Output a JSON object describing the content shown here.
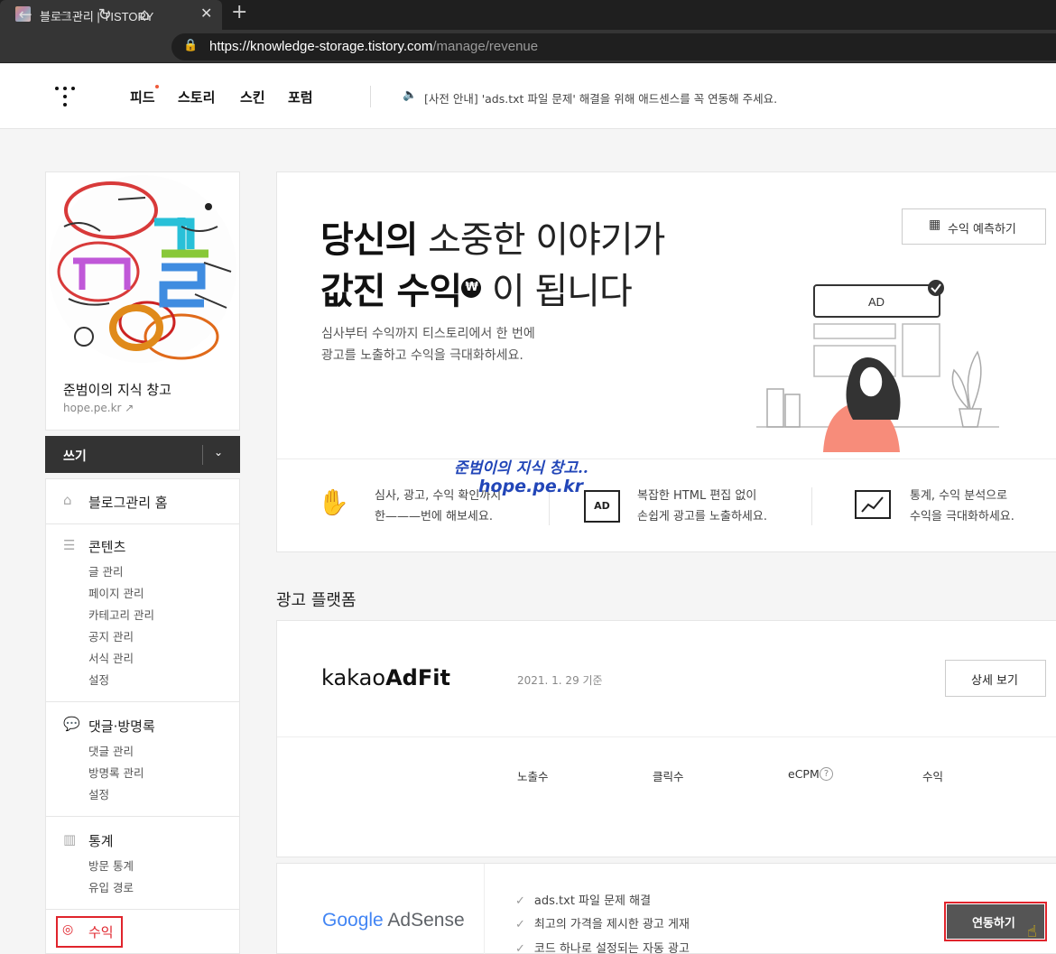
{
  "browser": {
    "tab_title": "블로그관리 | TISTORY",
    "close_glyph": "✕",
    "newtab_glyph": "+",
    "url_host": "https://knowledge-storage.tistory.com",
    "url_path": "/manage/revenue",
    "back": "←",
    "forward": "→",
    "reload": "↻",
    "home": "⌂",
    "lock": "🔒"
  },
  "topnav": {
    "items": [
      "피드",
      "스토리",
      "스킨",
      "포럼"
    ],
    "notice": "[사전 안내] 'ads.txt 파일 문제' 해결을 위해 애드센스를 꼭 연동해 주세요.",
    "speaker": "🔈"
  },
  "sidebar": {
    "blog_name": "준범이의 지식 창고",
    "blog_url": "hope.pe.kr ↗",
    "write_label": "쓰기",
    "write_dropdown": "⌄",
    "home_label": "블로그관리 홈",
    "sections": [
      {
        "title": "콘텐츠",
        "items": [
          "글 관리",
          "페이지 관리",
          "카테고리 관리",
          "공지 관리",
          "서식 관리",
          "설정"
        ]
      },
      {
        "title": "댓글·방명록",
        "items": [
          "댓글 관리",
          "방명록 관리",
          "설정"
        ]
      },
      {
        "title": "통계",
        "items": [
          "방문 통계",
          "유입 경로"
        ]
      }
    ],
    "revenue_label": "수익"
  },
  "hero": {
    "line1_bold": "당신의",
    "line1_light": " 소중한 이야기가",
    "line2_bold": "값진 수익",
    "line2_light": " 이 됩니다",
    "won": "₩",
    "desc1": "심사부터 수익까지 티스토리에서 한 번에",
    "desc2": "광고를 노출하고 수익을 극대화하세요.",
    "predict_label": "수익 예측하기",
    "ad_label": "AD",
    "features": [
      {
        "line1": "심사, 광고, 수익 확인까지",
        "line2": "한———번에 해보세요."
      },
      {
        "line1": "복잡한 HTML 편집 없이",
        "line2": "손쉽게 광고를 노출하세요."
      },
      {
        "line1": "통계, 수익 분석으로",
        "line2": "수익을 극대화하세요."
      }
    ],
    "overlay_name": "준범이의 지식 창고..",
    "overlay_url": "hope.pe.kr"
  },
  "platform": {
    "title": "광고 플랫폼",
    "adfit_logo_light": "kakao",
    "adfit_logo_bold": "AdFit",
    "adfit_date": "2021. 1. 29 기준",
    "detail_label": "상세 보기",
    "columns": [
      "노출수",
      "클릭수",
      "eCPM",
      "수익"
    ],
    "adsense_logo_google": "Google",
    "adsense_logo_adsense": " AdSense",
    "adsense_checks": [
      "ads.txt 파일 문제 해결",
      "최고의 가격을 제시한 광고 게재",
      "코드 하나로 설정되는 자동 광고"
    ],
    "connect_label": "연동하기"
  },
  "colors": {
    "accent_red": "#e0242c",
    "dark": "#333333",
    "feed_dot": "#ef5b3a"
  }
}
